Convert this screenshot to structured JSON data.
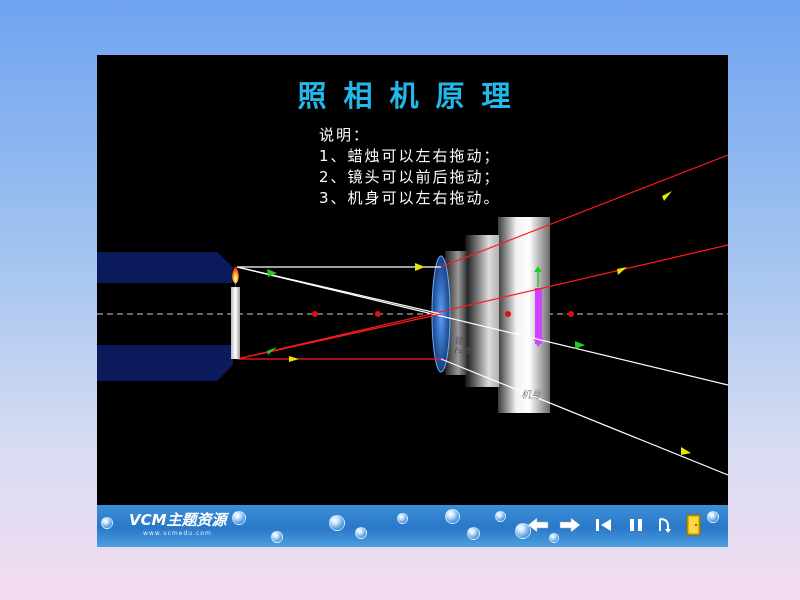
{
  "title": "照相机原理",
  "notes": {
    "heading": "说明：",
    "items": [
      "1、蜡烛可以左右拖动；",
      "2、镜头可以前后拖动；",
      "3、机身可以左右拖动。"
    ]
  },
  "lens_label": "镜\nf=8",
  "body_label": "机身",
  "logo": {
    "main": "VCM主题资源",
    "sub": "www.vcmedu.com"
  },
  "toolbar_icons": [
    "arrow-left-icon",
    "arrow-right-icon",
    "rewind-icon",
    "pause-icon",
    "return-icon",
    "exit-door-icon"
  ],
  "colors": {
    "title": "#22b8ea",
    "ray_white": "#ffffff",
    "ray_red": "#ff1a1a",
    "arrow": "#e6e600",
    "arrow_green": "#22cc22",
    "toolbar": "#2a78c8"
  }
}
